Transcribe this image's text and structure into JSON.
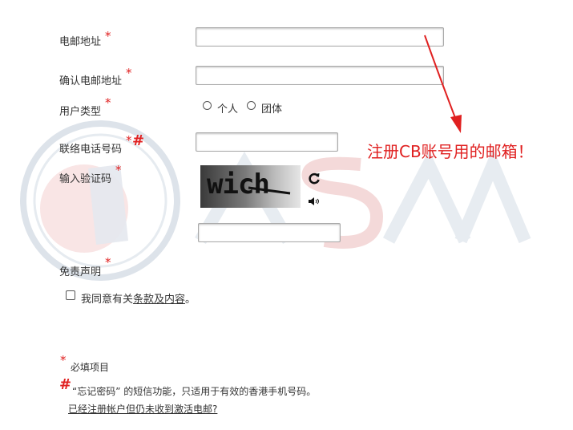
{
  "form": {
    "email_label": "电邮地址",
    "confirm_email_label": "确认电邮地址",
    "user_type_label": "用户类型",
    "user_type_options": [
      "个人",
      "团体"
    ],
    "phone_label": "联络电话号码",
    "captcha_label": "输入验证码",
    "captcha_text": "wich",
    "disclaimer_label": "免责声明",
    "agree_prefix": "我同意有关",
    "agree_link": "条款及内容",
    "agree_suffix": "。",
    "required_mark": "*",
    "hash_mark": "#"
  },
  "legend": {
    "required_note": "必填项目",
    "hash_note": "“忘记密码” 的短信功能，只适用于有效的香港手机号码。",
    "resend_link": "已经注册帐户但仍未收到激活电邮?"
  },
  "annotation": {
    "text": "注册CB账号用的邮箱！",
    "color": "#e02020"
  },
  "watermark": {
    "text": "ASAA",
    "color_blue": "#b8c6d4",
    "color_red": "#f2c8c8"
  }
}
